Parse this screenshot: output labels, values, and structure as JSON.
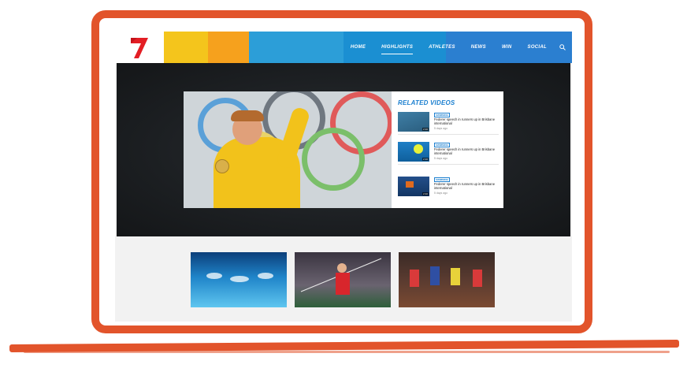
{
  "header": {
    "nav": [
      "HOME",
      "HIGHLIGHTS",
      "ATHLETES",
      "NEWS",
      "WIN",
      "SOCIAL"
    ],
    "active_nav": "HIGHLIGHTS"
  },
  "colors": {
    "frame": "#e2542b",
    "accent_blue": "#1b7fcf",
    "brand_red": "#e31e24"
  },
  "related": {
    "title": "RELATED VIDEOS",
    "items": [
      {
        "category": "SWIMMING",
        "title": "Federer speech in runners up in Brisbane international",
        "time": "5 days ago",
        "duration": "2:10"
      },
      {
        "category": "SWIMMING",
        "title": "Federer speech in runners up in Brisbane international",
        "time": "5 days ago",
        "duration": "2:10"
      },
      {
        "category": "SWIMMING",
        "title": "Federer speech in runners up in Brisbane international",
        "time": "5 days ago",
        "duration": "2:10"
      }
    ]
  },
  "cards": [
    {
      "label": ""
    },
    {
      "label": ""
    },
    {
      "label": ""
    }
  ]
}
